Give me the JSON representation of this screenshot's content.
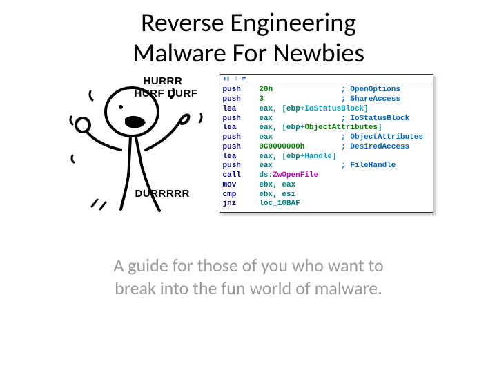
{
  "title_line1": "Reverse Engineering",
  "title_line2": "Malware For Newbies",
  "meme": {
    "text1": "HURRR",
    "text2": "HURF DURF",
    "text3": "DURRRRR"
  },
  "disasm": {
    "lines": [
      {
        "mnem": "push",
        "op": "20h",
        "cmt": "; OpenOptions",
        "opClass": "c-green"
      },
      {
        "mnem": "push",
        "op": "3",
        "cmt": "; ShareAccess",
        "opClass": "c-green"
      },
      {
        "mnem": "lea",
        "op": "eax, [ebp+",
        "op2": "IoStatusBlock",
        "op3": "]",
        "opClass": "c-teal",
        "op2Class": "c-cyan"
      },
      {
        "mnem": "push",
        "op": "eax",
        "cmt": "; IoStatusBlock",
        "opClass": "c-teal"
      },
      {
        "mnem": "lea",
        "op": "eax, [ebp+",
        "op2": "ObjectAttributes",
        "op3": "]",
        "opClass": "c-teal",
        "op2Class": "c-green"
      },
      {
        "mnem": "push",
        "op": "eax",
        "cmt": "; ObjectAttributes",
        "opClass": "c-teal"
      },
      {
        "mnem": "push",
        "op": "0C0000000h",
        "cmt": "; DesiredAccess",
        "opClass": "c-green"
      },
      {
        "mnem": "lea",
        "op": "eax, [ebp+",
        "op2": "Handle",
        "op3": "]",
        "opClass": "c-teal",
        "op2Class": "c-cyan"
      },
      {
        "mnem": "push",
        "op": "eax",
        "cmt": "; FileHandle",
        "opClass": "c-teal"
      },
      {
        "mnem": "call",
        "op": "ds:",
        "op2": "ZwOpenFile",
        "opClass": "c-teal",
        "op2Class": "c-magenta"
      },
      {
        "mnem": "mov",
        "op": "ebx, eax",
        "opClass": "c-teal"
      },
      {
        "mnem": "cmp",
        "op": "ebx, esi",
        "opClass": "c-teal"
      },
      {
        "mnem": "jnz",
        "op": "loc_10BAF",
        "opClass": "c-teal"
      }
    ]
  },
  "subtitle_line1": "A guide for those of you who want to",
  "subtitle_line2": "break into the fun world of malware."
}
